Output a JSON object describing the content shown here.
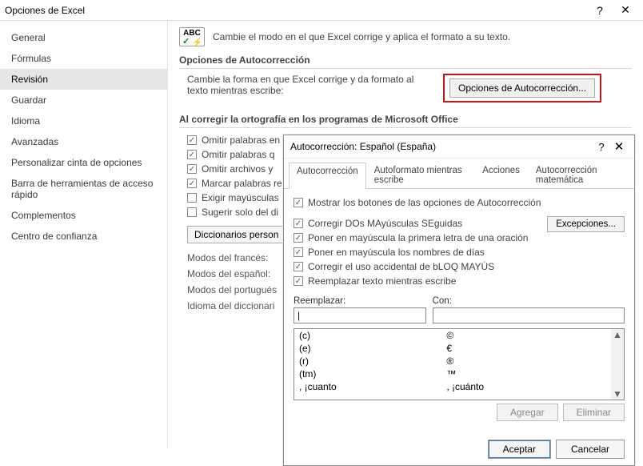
{
  "window": {
    "title": "Opciones de Excel"
  },
  "sidebar": {
    "items": [
      {
        "label": "General"
      },
      {
        "label": "Fórmulas"
      },
      {
        "label": "Revisión"
      },
      {
        "label": "Guardar"
      },
      {
        "label": "Idioma"
      },
      {
        "label": "Avanzadas"
      },
      {
        "label": "Personalizar cinta de opciones"
      },
      {
        "label": "Barra de herramientas de acceso rápido"
      },
      {
        "label": "Complementos"
      },
      {
        "label": "Centro de confianza"
      }
    ],
    "active_index": 2
  },
  "content": {
    "intro": "Cambie el modo en el que Excel corrige y aplica el formato a su texto.",
    "abc_label": "ABC",
    "section1_title": "Opciones de Autocorrección",
    "section1_desc": "Cambie la forma en que Excel corrige y da formato al texto mientras escribe:",
    "ac_button": "Opciones de Autocorrección...",
    "section2_title": "Al corregir la ortografía en los programas de Microsoft Office",
    "checks": [
      {
        "label": "Omitir palabras en",
        "checked": true
      },
      {
        "label": "Omitir palabras q",
        "checked": true
      },
      {
        "label": "Omitir archivos y",
        "checked": true
      },
      {
        "label": "Marcar palabras re",
        "checked": true
      },
      {
        "label": "Exigir mayúsculas",
        "checked": false
      },
      {
        "label": "Sugerir solo del di",
        "checked": false
      }
    ],
    "dict_button": "Diccionarios person",
    "modes": [
      "Modos del francés:",
      "Modos del español:",
      "Modos del portugués",
      "Idioma del diccionari"
    ]
  },
  "dialog": {
    "title": "Autocorrección: Español (España)",
    "tabs": [
      "Autocorrección",
      "Autoformato mientras escribe",
      "Acciones",
      "Autocorrección matemática"
    ],
    "active_tab": 0,
    "show_buttons_label": "Mostrar los botones de las opciones de Autocorrección",
    "rules": [
      {
        "label": "Corregir DOs MAyúsculas SEguidas",
        "checked": true
      },
      {
        "label": "Poner en mayúscula la primera letra de una oración",
        "checked": true
      },
      {
        "label": "Poner en mayúscula los nombres de días",
        "checked": true
      },
      {
        "label": "Corregir el uso accidental de bLOQ MAYÚS",
        "checked": true
      },
      {
        "label": "Reemplazar texto mientras escribe",
        "checked": true
      }
    ],
    "exceptions_btn": "Excepciones...",
    "replace_label": "Reemplazar:",
    "with_label": "Con:",
    "replace_value": "|",
    "with_value": "",
    "list": [
      {
        "from": "(c)",
        "to": "©"
      },
      {
        "from": "(e)",
        "to": "€"
      },
      {
        "from": "(r)",
        "to": "®"
      },
      {
        "from": "(tm)",
        "to": "™"
      },
      {
        "from": ", ¡cuanto",
        "to": ", ¡cuánto"
      }
    ],
    "add_btn": "Agregar",
    "del_btn": "Eliminar",
    "ok_btn": "Aceptar",
    "cancel_btn": "Cancelar"
  }
}
